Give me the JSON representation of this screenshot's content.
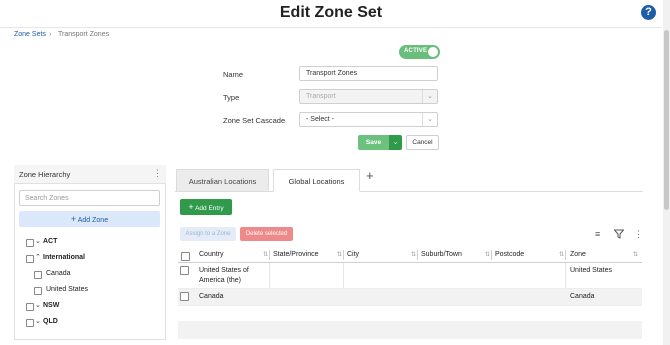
{
  "header": {
    "title": "Edit Zone Set",
    "help_icon": "?"
  },
  "breadcrumb": {
    "parent": "Zone Sets",
    "separator": "›",
    "current": "Transport Zones"
  },
  "status_toggle": {
    "label": "ACTIVE",
    "on": true,
    "color": "#69be7b"
  },
  "form": {
    "name_label": "Name",
    "name_value": "Transport Zones",
    "type_label": "Type",
    "type_value": "Transport",
    "cascade_label": "Zone Set Cascade",
    "cascade_value": "- Select -",
    "save_label": "Save",
    "cancel_label": "Cancel"
  },
  "zone_hierarchy": {
    "title": "Zone Hierarchy",
    "search_placeholder": "Search Zones",
    "add_zone_label": "Add Zone",
    "items": [
      {
        "label": "ACT",
        "bold": true,
        "expanded": false
      },
      {
        "label": "International",
        "bold": true,
        "expanded": true
      },
      {
        "label": "Canada",
        "bold": false
      },
      {
        "label": "United States",
        "bold": false
      },
      {
        "label": "NSW",
        "bold": true,
        "expanded": false
      },
      {
        "label": "QLD",
        "bold": true,
        "expanded": false
      }
    ]
  },
  "tabs": [
    {
      "label": "Australian Locations",
      "active": false
    },
    {
      "label": "Global Locations",
      "active": true
    }
  ],
  "toolbar": {
    "add_entry_label": "Add Entry",
    "assign_label": "Assign to a Zone",
    "delete_label": "Delete selected"
  },
  "table": {
    "columns": [
      "Country",
      "State/Province",
      "City",
      "Suburb/Town",
      "Postcode",
      "Zone"
    ],
    "rows": [
      {
        "country_line1": "United States of",
        "country_line2": "America (the)",
        "state": "",
        "city": "",
        "suburb": "",
        "postcode": "",
        "zone": "United States"
      },
      {
        "country_line1": "Canada",
        "country_line2": "",
        "state": "",
        "city": "",
        "suburb": "",
        "postcode": "",
        "zone": "Canada"
      }
    ]
  },
  "colors": {
    "primary_blue": "#1f5da7",
    "green": "#2e9a4a",
    "red": "#ee8a8a"
  }
}
